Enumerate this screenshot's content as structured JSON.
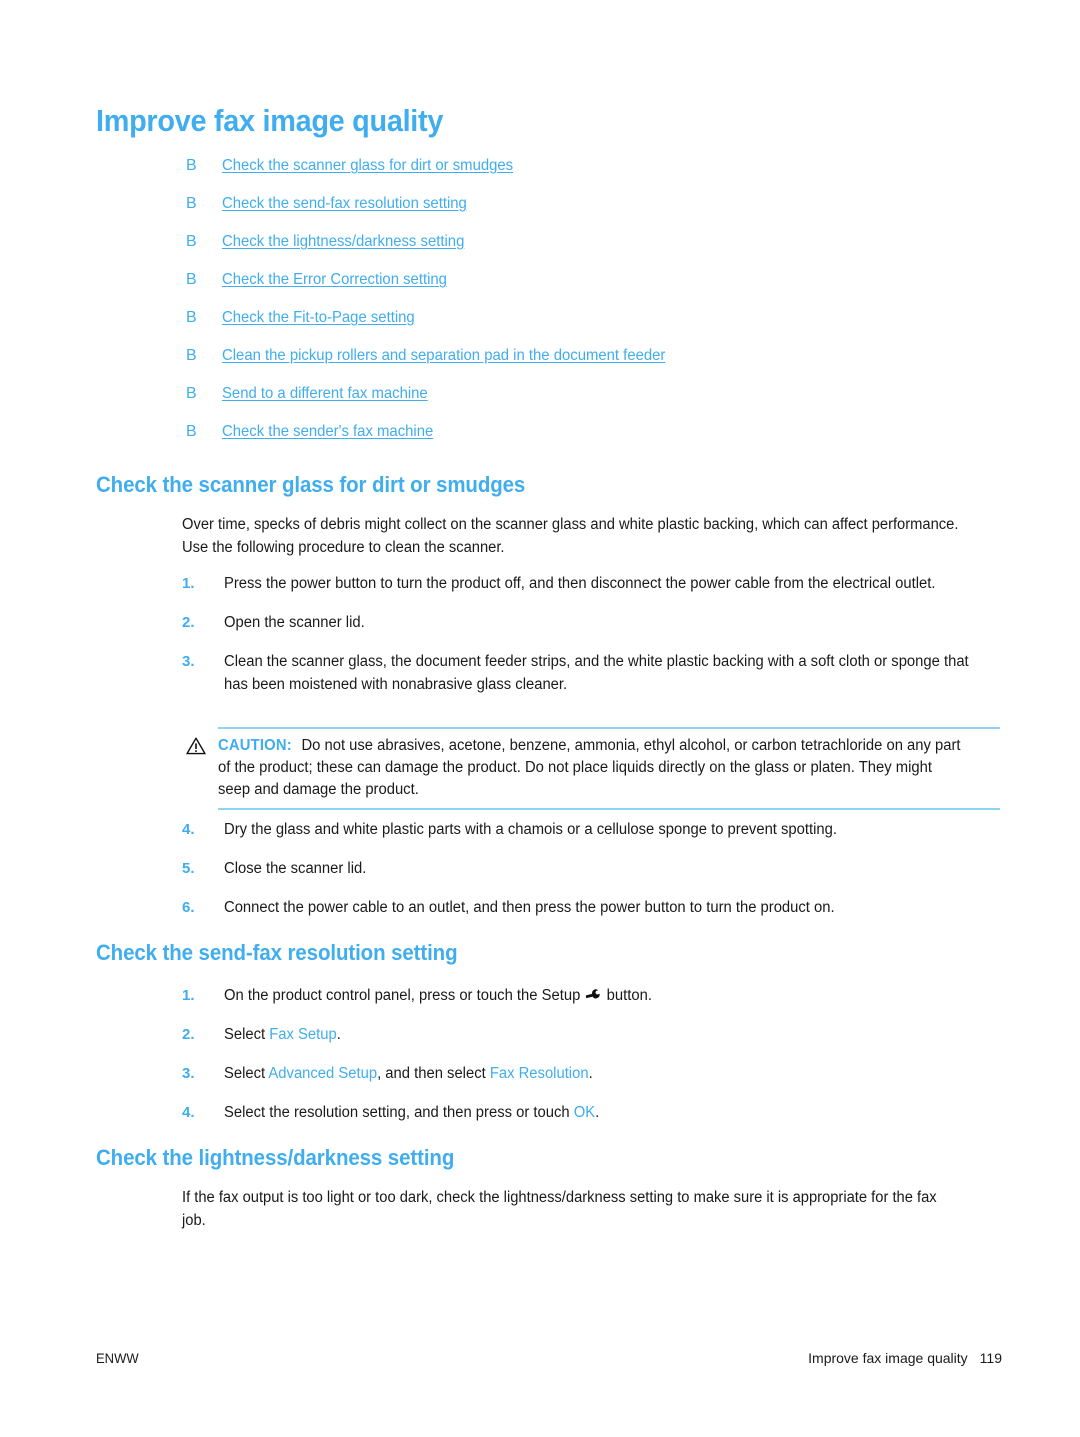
{
  "page": {
    "title": "Improve fax image quality"
  },
  "toc": {
    "bullet_glyph": "B",
    "items": [
      {
        "label": "Check the scanner glass for dirt or smudges"
      },
      {
        "label": "Check the send-fax resolution setting"
      },
      {
        "label": "Check the lightness/darkness setting"
      },
      {
        "label": "Check the Error Correction setting"
      },
      {
        "label": "Check the Fit-to-Page setting"
      },
      {
        "label": "Clean the pickup rollers and separation pad in the document feeder"
      },
      {
        "label": "Send to a different fax machine"
      },
      {
        "label": "Check the sender's fax machine"
      }
    ]
  },
  "section1": {
    "heading": "Check the scanner glass for dirt or smudges",
    "intro": "Over time, specks of debris might collect on the scanner glass and white plastic backing, which can affect performance. Use the following procedure to clean the scanner.",
    "steps": [
      {
        "num": "1.",
        "text": "Press the power button to turn the product off, and then disconnect the power cable from the electrical outlet."
      },
      {
        "num": "2.",
        "text": "Open the scanner lid."
      },
      {
        "num": "3.",
        "text": "Clean the scanner glass, the document feeder strips, and the white plastic backing with a soft cloth or sponge that has been moistened with nonabrasive glass cleaner."
      }
    ],
    "caution": {
      "icon_name": "warning-triangle-icon",
      "label": "CAUTION:",
      "text": "Do not use abrasives, acetone, benzene, ammonia, ethyl alcohol, or carbon tetrachloride on any part of the product; these can damage the product. Do not place liquids directly on the glass or platen. They might seep and damage the product."
    },
    "steps2": [
      {
        "num": "4.",
        "text": "Dry the glass and white plastic parts with a chamois or a cellulose sponge to prevent spotting."
      },
      {
        "num": "5.",
        "text": "Close the scanner lid."
      },
      {
        "num": "6.",
        "text": "Connect the power cable to an outlet, and then press the power button to turn the product on."
      }
    ]
  },
  "section2": {
    "heading": "Check the send-fax resolution setting",
    "steps": {
      "s1": {
        "num": "1.",
        "before": "On the product control panel, press or touch the Setup ",
        "after": " button."
      },
      "s2": {
        "num": "2.",
        "before": "Select ",
        "term": "Fax Setup",
        "after": "."
      },
      "s3": {
        "num": "3.",
        "before": "Select ",
        "term1": "Advanced Setup",
        "middle": ", and then select ",
        "term2": "Fax Resolution",
        "after": "."
      },
      "s4": {
        "num": "4.",
        "before": "Select the resolution setting, and then press or touch ",
        "term": "OK",
        "after": "."
      }
    }
  },
  "section3": {
    "heading": "Check the lightness/darkness setting",
    "body": "If the fax output is too light or too dark, check the lightness/darkness setting to make sure it is appropriate for the fax job."
  },
  "footer": {
    "left": "ENWW",
    "right_title": "Improve fax image quality",
    "page_number": "119"
  },
  "colors": {
    "accent_blue": "#3FADEE",
    "rule_blue": "#8FD3F4",
    "text_black": "#1a1a1a"
  }
}
